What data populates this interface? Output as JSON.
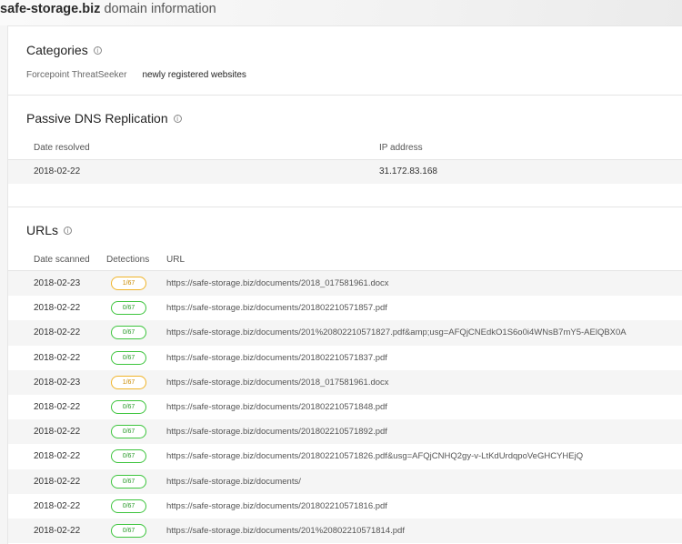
{
  "page": {
    "domain": "safe-storage.biz",
    "title_suffix": "domain information"
  },
  "categories": {
    "title": "Categories",
    "info_icon": "info-circle-icon",
    "source": "Forcepoint ThreatSeeker",
    "value": "newly registered websites"
  },
  "dns": {
    "title": "Passive DNS Replication",
    "info_icon": "info-circle-icon",
    "col_date": "Date resolved",
    "col_ip": "IP address",
    "rows": [
      {
        "date": "2018-02-22",
        "ip": "31.172.83.168"
      }
    ]
  },
  "urls": {
    "title": "URLs",
    "info_icon": "info-circle-icon",
    "col_date": "Date scanned",
    "col_detections": "Detections",
    "col_url": "URL",
    "rows": [
      {
        "date": "2018-02-23",
        "detections": "1/67",
        "url": "https://safe-storage.biz/documents/2018_017581961.docx"
      },
      {
        "date": "2018-02-22",
        "detections": "0/67",
        "url": "https://safe-storage.biz/documents/201802210571857.pdf"
      },
      {
        "date": "2018-02-22",
        "detections": "0/67",
        "url": "https://safe-storage.biz/documents/201%20802210571827.pdf&amp;usg=AFQjCNEdkO1S6o0i4WNsB7mY5-AElQBX0A"
      },
      {
        "date": "2018-02-22",
        "detections": "0/67",
        "url": "https://safe-storage.biz/documents/201802210571837.pdf"
      },
      {
        "date": "2018-02-23",
        "detections": "1/67",
        "url": "https://safe-storage.biz/documents/2018_017581961.docx"
      },
      {
        "date": "2018-02-22",
        "detections": "0/67",
        "url": "https://safe-storage.biz/documents/201802210571848.pdf"
      },
      {
        "date": "2018-02-22",
        "detections": "0/67",
        "url": "https://safe-storage.biz/documents/201802210571892.pdf"
      },
      {
        "date": "2018-02-22",
        "detections": "0/67",
        "url": "https://safe-storage.biz/documents/201802210571826.pdf&usg=AFQjCNHQ2gy-v-LtKdUrdqpoVeGHCYHEjQ"
      },
      {
        "date": "2018-02-22",
        "detections": "0/67",
        "url": "https://safe-storage.biz/documents/"
      },
      {
        "date": "2018-02-22",
        "detections": "0/67",
        "url": "https://safe-storage.biz/documents/201802210571816.pdf"
      },
      {
        "date": "2018-02-22",
        "detections": "0/67",
        "url": "https://safe-storage.biz/documents/201%20802210571814.pdf"
      }
    ]
  },
  "colors": {
    "badge_clean": "#3cc43c",
    "badge_warn": "#f0b429"
  }
}
